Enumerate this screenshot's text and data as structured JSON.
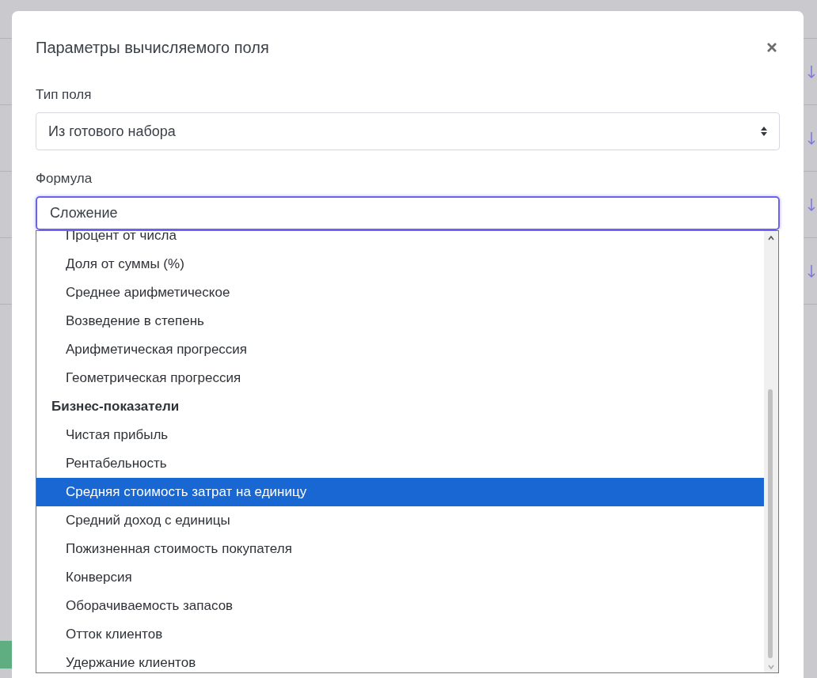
{
  "background": {
    "rows": [
      {
        "arrow": true
      },
      {
        "arrow": true
      },
      {
        "arrow": true
      },
      {
        "arrow": true
      },
      {
        "arrow": false
      }
    ]
  },
  "dialog": {
    "title": "Параметры вычисляемого поля",
    "field_type": {
      "label": "Тип поля",
      "value": "Из готового набора"
    },
    "formula": {
      "label": "Формула",
      "value": "Сложение",
      "options": [
        {
          "kind": "option",
          "label": "Процент от числа",
          "selected": false
        },
        {
          "kind": "option",
          "label": "Доля от суммы (%)",
          "selected": false
        },
        {
          "kind": "option",
          "label": "Среднее арифметическое",
          "selected": false
        },
        {
          "kind": "option",
          "label": "Возведение в степень",
          "selected": false
        },
        {
          "kind": "option",
          "label": "Арифметическая прогрессия",
          "selected": false
        },
        {
          "kind": "option",
          "label": "Геометрическая прогрессия",
          "selected": false
        },
        {
          "kind": "group",
          "label": "Бизнес-показатели"
        },
        {
          "kind": "option",
          "label": "Чистая прибыль",
          "selected": false
        },
        {
          "kind": "option",
          "label": "Рентабельность",
          "selected": false
        },
        {
          "kind": "option",
          "label": "Средняя стоимость затрат на единицу",
          "selected": true
        },
        {
          "kind": "option",
          "label": "Средний доход с единицы",
          "selected": false
        },
        {
          "kind": "option",
          "label": "Пожизненная стоимость покупателя",
          "selected": false
        },
        {
          "kind": "option",
          "label": "Конверсия",
          "selected": false
        },
        {
          "kind": "option",
          "label": "Оборачиваемость запасов",
          "selected": false
        },
        {
          "kind": "option",
          "label": "Отток клиентов",
          "selected": false
        },
        {
          "kind": "option",
          "label": "Удержание клиентов",
          "selected": false
        }
      ]
    }
  }
}
